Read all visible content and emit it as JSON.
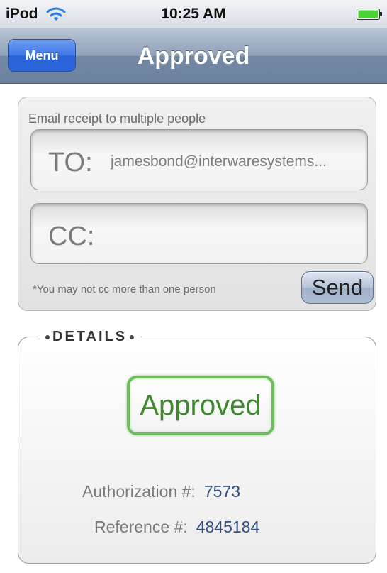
{
  "status_bar": {
    "carrier": "iPod",
    "time": "10:25 AM",
    "icons": [
      "wifi-icon",
      "battery-icon"
    ],
    "battery_color": "#4cd137"
  },
  "nav_bar": {
    "menu_label": "Menu",
    "title": "Approved"
  },
  "email_panel": {
    "heading": "Email receipt to multiple people",
    "to_label": "TO:",
    "to_value": "jamesbond@interwaresystems...",
    "cc_label": "CC:",
    "cc_value": "",
    "note": "*You may not cc more than one person",
    "send_label": "Send"
  },
  "details": {
    "legend": "DETAILS",
    "status": "Approved",
    "status_color": "#3c8a2c",
    "authorization_label": "Authorization #:",
    "authorization_value": "7573",
    "reference_label": "Reference #:",
    "reference_value": "4845184"
  }
}
